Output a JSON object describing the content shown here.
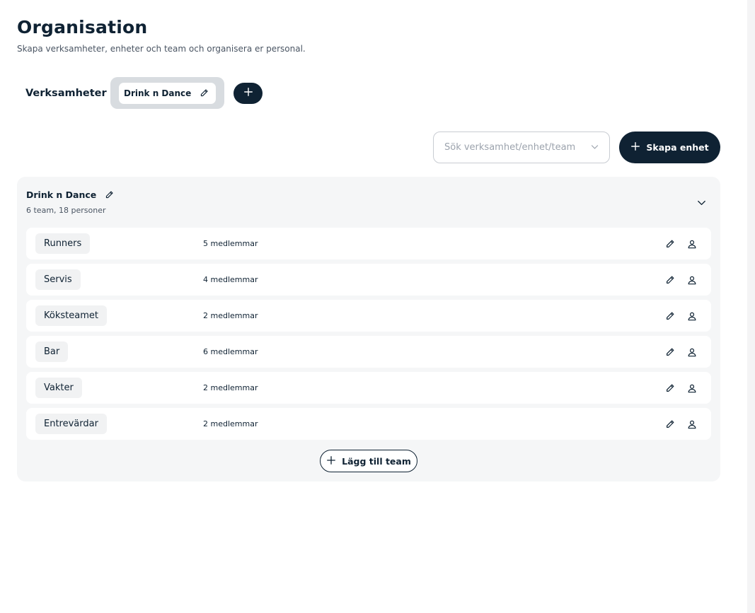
{
  "page": {
    "title": "Organisation",
    "subtitle": "Skapa verksamheter, enheter och team och organisera er personal."
  },
  "businesses": {
    "label": "Verksamheter",
    "tabs": [
      {
        "label": "Drink n Dance"
      }
    ]
  },
  "toolbar": {
    "search_placeholder": "Sök verksamhet/enhet/team",
    "create_label": "Skapa enhet"
  },
  "unit": {
    "name": "Drink n Dance",
    "meta": "6 team, 18 personer",
    "teams": [
      {
        "name": "Runners",
        "members": "5 medlemmar"
      },
      {
        "name": "Servis",
        "members": "4 medlemmar"
      },
      {
        "name": "Köksteamet",
        "members": "2 medlemmar"
      },
      {
        "name": "Bar",
        "members": "6 medlemmar"
      },
      {
        "name": "Vakter",
        "members": "2 medlemmar"
      },
      {
        "name": "Entrevärdar",
        "members": "2 medlemmar"
      }
    ],
    "add_team_label": "Lägg till team"
  },
  "colors": {
    "primary": "#0f2233",
    "card_bg": "#f5f6f7",
    "tab_group_bg": "#d8dce0"
  },
  "icons": {
    "edit": "pencil-icon",
    "members": "user-icon",
    "add": "plus-icon",
    "expand": "chevron-down-icon"
  }
}
